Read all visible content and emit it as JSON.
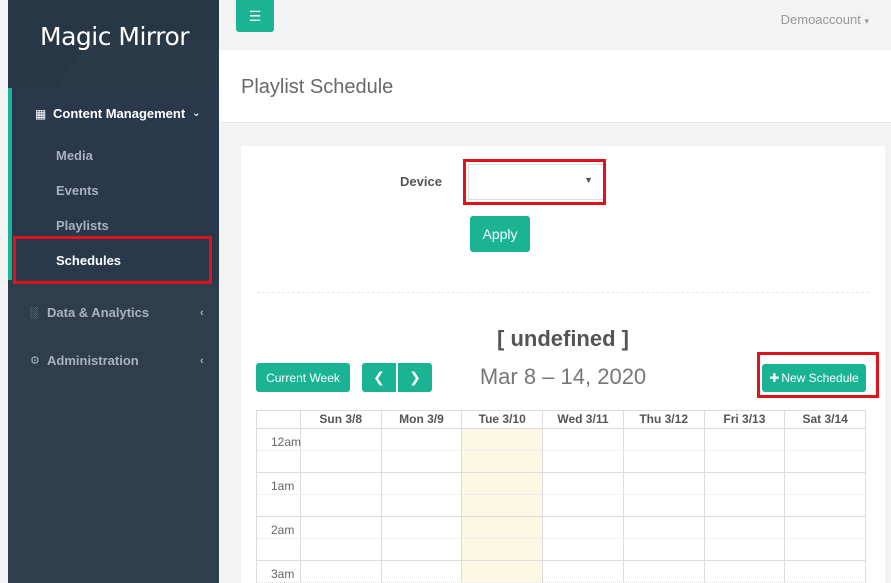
{
  "brand": {
    "logo_text": "Magic Mirror"
  },
  "topbar": {
    "account": "Demoaccount"
  },
  "sidebar": {
    "content_management": "Content Management",
    "sub_items": [
      "Media",
      "Events",
      "Playlists",
      "Schedules"
    ],
    "active_item": "Schedules",
    "data_analytics": "Data & Analytics",
    "administration": "Administration"
  },
  "page": {
    "title": "Playlist Schedule"
  },
  "form": {
    "device_label": "Device",
    "device_value": "",
    "apply_label": "Apply"
  },
  "calendar": {
    "title": "[ undefined ]",
    "current_week_label": "Current Week",
    "date_range": "Mar 8 – 14, 2020",
    "new_schedule_label": "New Schedule",
    "days": [
      "Sun 3/8",
      "Mon 3/9",
      "Tue 3/10",
      "Wed 3/11",
      "Thu 3/12",
      "Fri 3/13",
      "Sat 3/14"
    ],
    "today_index": 2,
    "hours": [
      "12am",
      "1am",
      "2am",
      "3am"
    ]
  },
  "colors": {
    "accent": "#1ab394",
    "sidebar_bg": "#2f3e4c",
    "highlight_box": "#e0131c",
    "today_bg": "#fcf8e3"
  }
}
